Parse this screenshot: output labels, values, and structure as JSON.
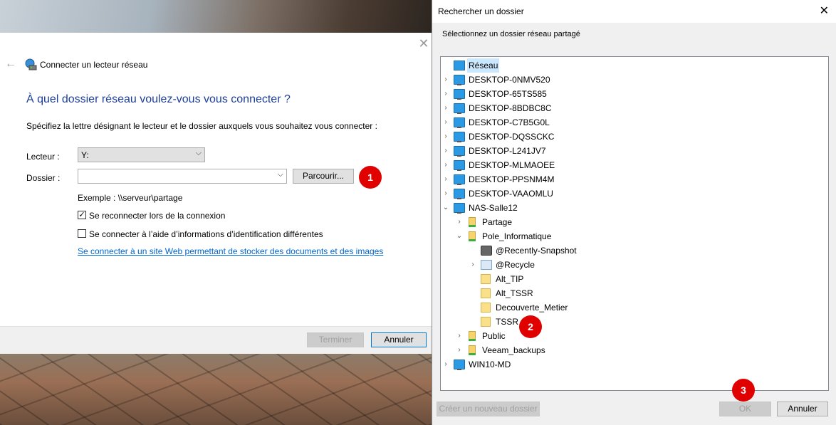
{
  "wizard": {
    "title": "Connecter un lecteur réseau",
    "heading": "À quel dossier réseau voulez-vous vous connecter ?",
    "instruction": "Spécifiez la lettre désignant le lecteur et le dossier auxquels vous souhaitez vous connecter :",
    "drive_label": "Lecteur :",
    "drive_value": "Y:",
    "folder_label": "Dossier :",
    "folder_value": "",
    "browse_button": "Parcourir...",
    "example": "Exemple : \\\\serveur\\partage",
    "reconnect_label": "Se reconnecter lors de la connexion",
    "reconnect_checked": true,
    "other_credentials_label": "Se connecter à l’aide d’informations d’identification différentes",
    "other_credentials_checked": false,
    "web_link": "Se connecter à un site Web permettant de stocker des documents et des images",
    "web_link_suffix": ".",
    "finish_button": "Terminer",
    "cancel_button": "Annuler",
    "close_glyph": "✕",
    "back_glyph": "←"
  },
  "badges": [
    "1",
    "2",
    "3"
  ],
  "browse": {
    "title": "Rechercher un dossier",
    "description": "Sélectionnez un dossier réseau partagé",
    "close_glyph": "✕",
    "tree": [
      {
        "label": "Réseau",
        "icon": "network-icon",
        "level": 0,
        "arrow": "",
        "selected": true
      },
      {
        "label": "DESKTOP-0NMV520",
        "icon": "computer-icon",
        "level": 0,
        "arrow": "›"
      },
      {
        "label": "DESKTOP-65TS585",
        "icon": "computer-icon",
        "level": 0,
        "arrow": "›"
      },
      {
        "label": "DESKTOP-8BDBC8C",
        "icon": "computer-icon",
        "level": 0,
        "arrow": "›"
      },
      {
        "label": "DESKTOP-C7B5G0L",
        "icon": "computer-icon",
        "level": 0,
        "arrow": "›"
      },
      {
        "label": "DESKTOP-DQSSCKC",
        "icon": "computer-icon",
        "level": 0,
        "arrow": "›"
      },
      {
        "label": "DESKTOP-L241JV7",
        "icon": "computer-icon",
        "level": 0,
        "arrow": "›"
      },
      {
        "label": "DESKTOP-MLMAOEE",
        "icon": "computer-icon",
        "level": 0,
        "arrow": "›"
      },
      {
        "label": "DESKTOP-PPSNM4M",
        "icon": "computer-icon",
        "level": 0,
        "arrow": "›"
      },
      {
        "label": "DESKTOP-VAAOMLU",
        "icon": "computer-icon",
        "level": 0,
        "arrow": "›"
      },
      {
        "label": "NAS-Salle12",
        "icon": "computer-icon",
        "level": 0,
        "arrow": "⌄"
      },
      {
        "label": "Partage",
        "icon": "shared-folder-icon",
        "level": 1,
        "arrow": "›"
      },
      {
        "label": "Pole_Informatique",
        "icon": "shared-folder-icon",
        "level": 1,
        "arrow": "⌄"
      },
      {
        "label": "@Recently-Snapshot",
        "icon": "camera-icon",
        "level": 2,
        "arrow": ""
      },
      {
        "label": "@Recycle",
        "icon": "recycle-icon",
        "level": 2,
        "arrow": "›"
      },
      {
        "label": "Alt_TIP",
        "icon": "folder-icon",
        "level": 2,
        "arrow": ""
      },
      {
        "label": "Alt_TSSR",
        "icon": "folder-icon",
        "level": 2,
        "arrow": ""
      },
      {
        "label": "Decouverte_Metier",
        "icon": "folder-icon",
        "level": 2,
        "arrow": ""
      },
      {
        "label": "TSSR",
        "icon": "folder-icon",
        "level": 2,
        "arrow": ""
      },
      {
        "label": "Public",
        "icon": "shared-folder-icon",
        "level": 1,
        "arrow": "›"
      },
      {
        "label": "Veeam_backups",
        "icon": "shared-folder-icon",
        "level": 1,
        "arrow": "›"
      },
      {
        "label": "WIN10-MD",
        "icon": "computer-icon",
        "level": 0,
        "arrow": "›"
      }
    ],
    "new_folder_button": "Créer un nouveau dossier",
    "ok_button": "OK",
    "cancel_button": "Annuler"
  },
  "colors": {
    "heading": "#1e3e9b",
    "link": "#0066cc",
    "badge": "#e00000",
    "selection": "#cce8ff"
  }
}
